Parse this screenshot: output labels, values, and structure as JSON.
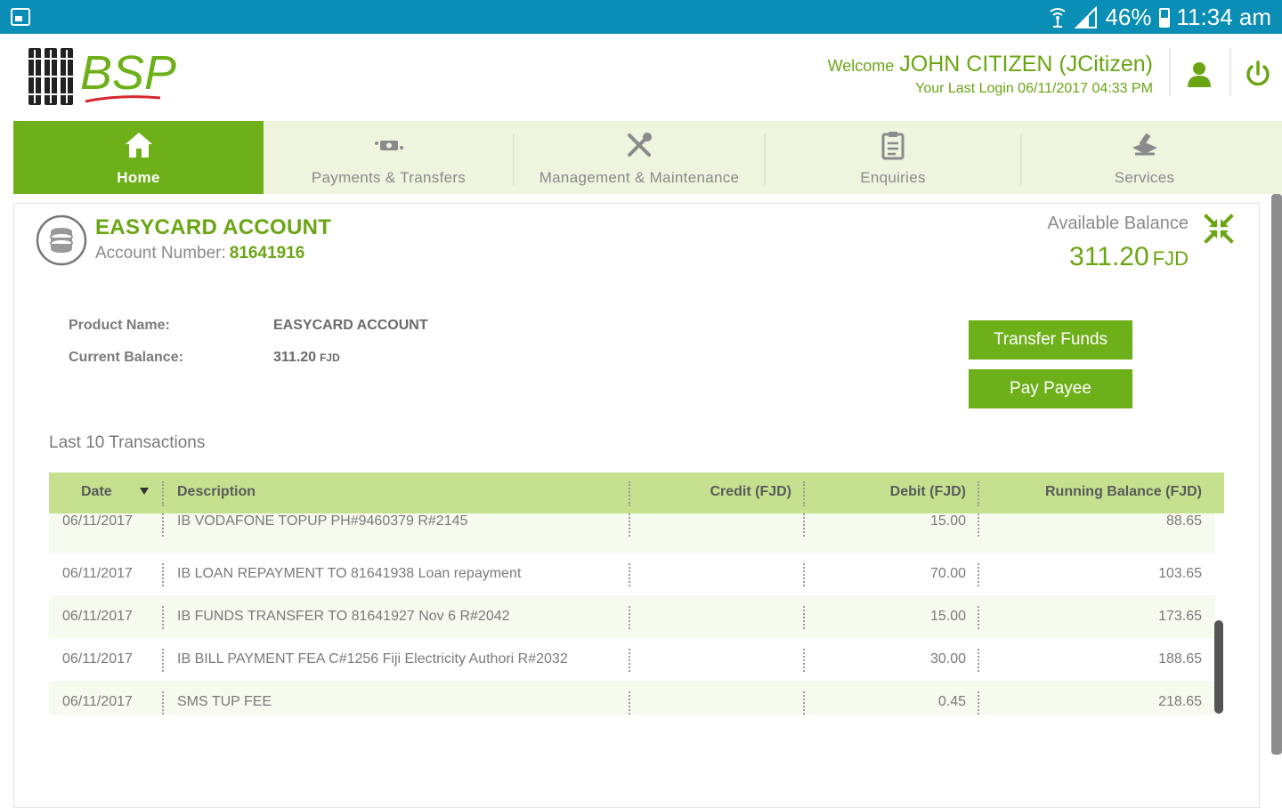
{
  "status_bar": {
    "battery": "46%",
    "time": "11:34 am",
    "icons": [
      "screenshot-icon",
      "wifi-icon",
      "signal-icon",
      "battery-icon"
    ]
  },
  "header": {
    "logo_text": "BSP",
    "welcome_word": "Welcome",
    "user_name": "JOHN CITIZEN (JCitizen)",
    "last_login": "Your Last Login 06/11/2017 04:33 PM"
  },
  "nav": {
    "items": [
      {
        "label": "Home",
        "icon": "home-icon",
        "active": true
      },
      {
        "label": "Payments & Transfers",
        "icon": "money-icon",
        "active": false
      },
      {
        "label": "Management & Maintenance",
        "icon": "tools-icon",
        "active": false
      },
      {
        "label": "Enquiries",
        "icon": "clipboard-icon",
        "active": false
      },
      {
        "label": "Services",
        "icon": "services-icon",
        "active": false
      }
    ]
  },
  "account": {
    "title": "EASYCARD ACCOUNT",
    "number_label": "Account Number:",
    "number": "81641916",
    "available_label": "Available Balance",
    "available_amount": "311.20",
    "available_currency": "FJD"
  },
  "details": {
    "product_name_label": "Product Name:",
    "product_name": "EASYCARD ACCOUNT",
    "current_balance_label": "Current Balance:",
    "current_balance": "311.20",
    "current_balance_currency": "FJD"
  },
  "actions": {
    "transfer_funds": "Transfer Funds",
    "pay_payee": "Pay Payee"
  },
  "transactions": {
    "title": "Last 10 Transactions",
    "columns": [
      "Date",
      "Description",
      "Credit (FJD)",
      "Debit (FJD)",
      "Running Balance (FJD)"
    ],
    "rows": [
      {
        "date": "06/11/2017",
        "description": "IB VODAFONE TOPUP PH#9460379 R#2145",
        "credit": "",
        "debit": "15.00",
        "balance": "88.65"
      },
      {
        "date": "06/11/2017",
        "description": "IB LOAN REPAYMENT TO 81641938 Loan repayment",
        "credit": "",
        "debit": "70.00",
        "balance": "103.65"
      },
      {
        "date": "06/11/2017",
        "description": "IB FUNDS TRANSFER TO 81641927 Nov 6 R#2042",
        "credit": "",
        "debit": "15.00",
        "balance": "173.65"
      },
      {
        "date": "06/11/2017",
        "description": "IB BILL PAYMENT FEA C#1256 Fiji Electricity Authori R#2032",
        "credit": "",
        "debit": "30.00",
        "balance": "188.65"
      },
      {
        "date": "06/11/2017",
        "description": "SMS TUP FEE",
        "credit": "",
        "debit": "0.45",
        "balance": "218.65"
      }
    ]
  },
  "colors": {
    "status_bar": "#0a8eb5",
    "brand_green": "#6eb01a",
    "text_green": "#6aa513",
    "nav_bg": "#eef4de",
    "table_header": "#c5e18f",
    "logo_red": "#d6262b"
  }
}
